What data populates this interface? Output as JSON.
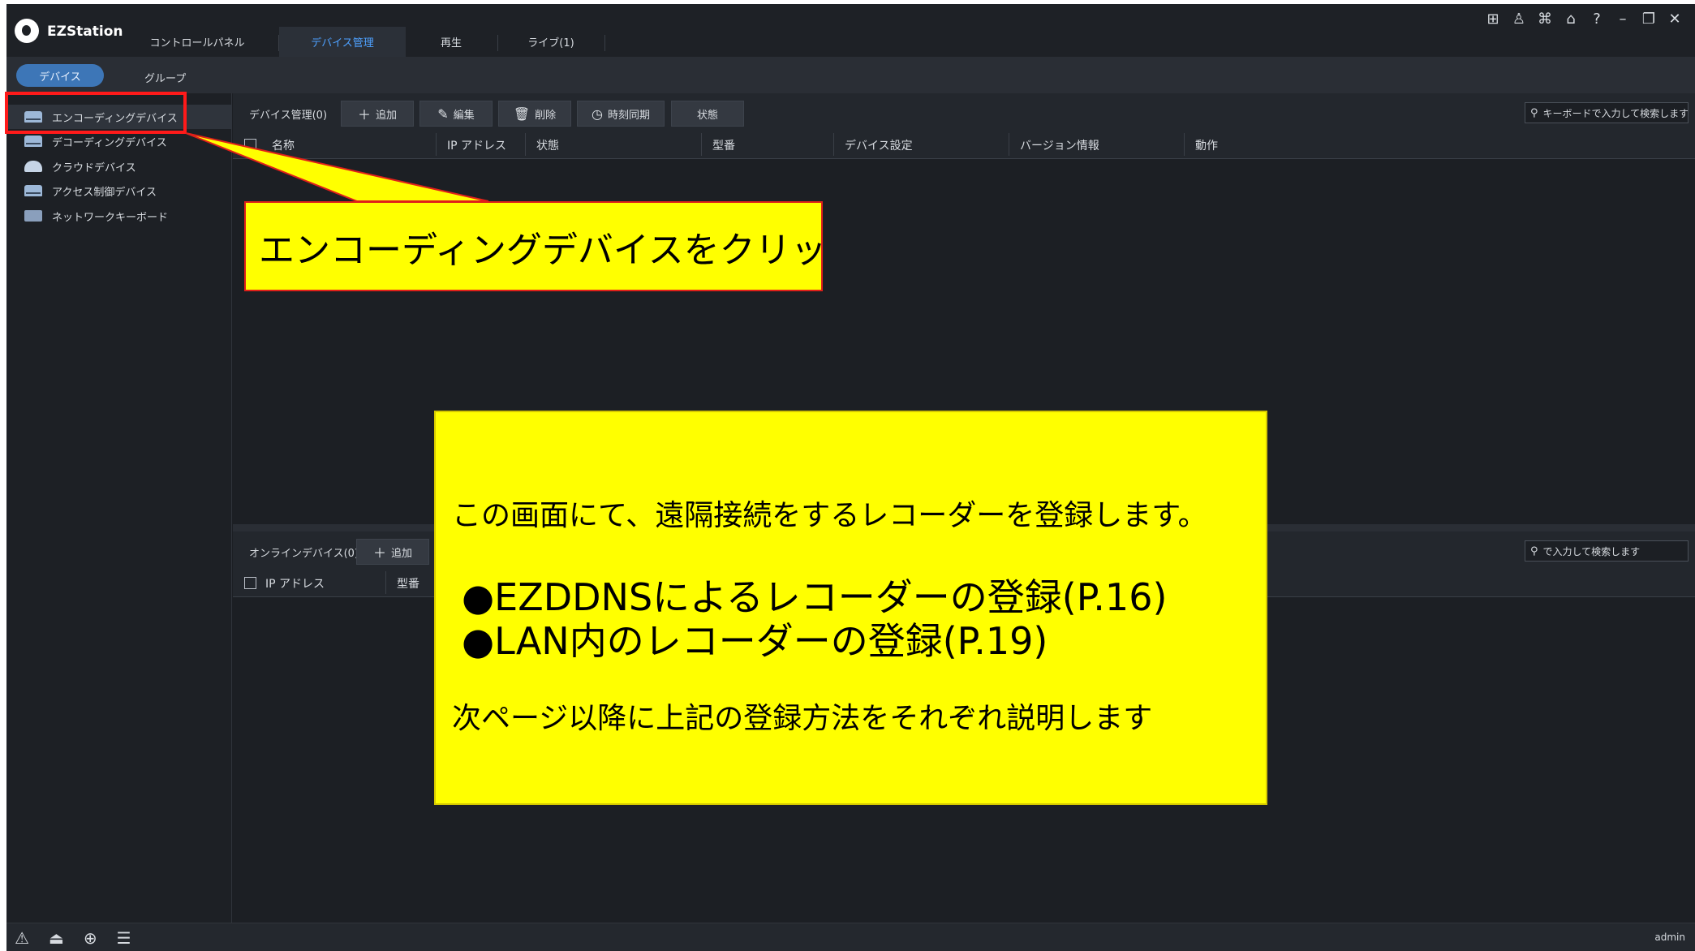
{
  "app": {
    "name": "EZStation",
    "tabs": [
      {
        "label": "コントロールパネル",
        "active": false
      },
      {
        "label": "デバイス管理",
        "active": true
      },
      {
        "label": "再生",
        "active": false
      },
      {
        "label": "ライブ(1)",
        "active": false
      }
    ],
    "window_icons": [
      "grid-view-icon",
      "shirt-icon",
      "network-icon",
      "lock-icon",
      "help-icon",
      "minimize-icon",
      "restore-icon",
      "close-icon"
    ]
  },
  "subtabs": {
    "device": "デバイス",
    "group": "グループ"
  },
  "sidebar": {
    "items": [
      {
        "label": "エンコーディングデバイス",
        "active": true
      },
      {
        "label": "デコーディングデバイス",
        "active": false
      },
      {
        "label": "クラウドデバイス",
        "active": false
      },
      {
        "label": "アクセス制御デバイス",
        "active": false
      },
      {
        "label": "ネットワークキーボード",
        "active": false
      }
    ]
  },
  "device_panel": {
    "title": "デバイス管理(0)",
    "buttons": {
      "add": "追加",
      "edit": "編集",
      "delete": "削除",
      "timesync": "時刻同期",
      "status": "状態"
    },
    "search_placeholder": "キーボードで入力して検索します",
    "columns": [
      "名称",
      "IP アドレス",
      "状態",
      "型番",
      "デバイス設定",
      "バージョン情報",
      "動作"
    ]
  },
  "online_panel": {
    "title": "オンラインデバイス(0)",
    "add": "追加",
    "search_placeholder": "で入力して検索します",
    "columns": [
      "IP アドレス",
      "型番"
    ]
  },
  "statusbar": {
    "user": "admin"
  },
  "annotations": {
    "callout_click": "エンコーディングデバイスをクリック",
    "intro": "この画面にて、遠隔接続をするレコーダーを登録します。",
    "bullet1": "●EZDDNSによるレコーダーの登録(P.16)",
    "bullet2": "●LAN内のレコーダーの登録(P.19)",
    "footer": "次ページ以降に上記の登録方法をそれぞれ説明します",
    "colors": {
      "callout_fill": "#ffff00",
      "highlight": "#ff1a1a",
      "accent": "#4ea1ff"
    }
  }
}
